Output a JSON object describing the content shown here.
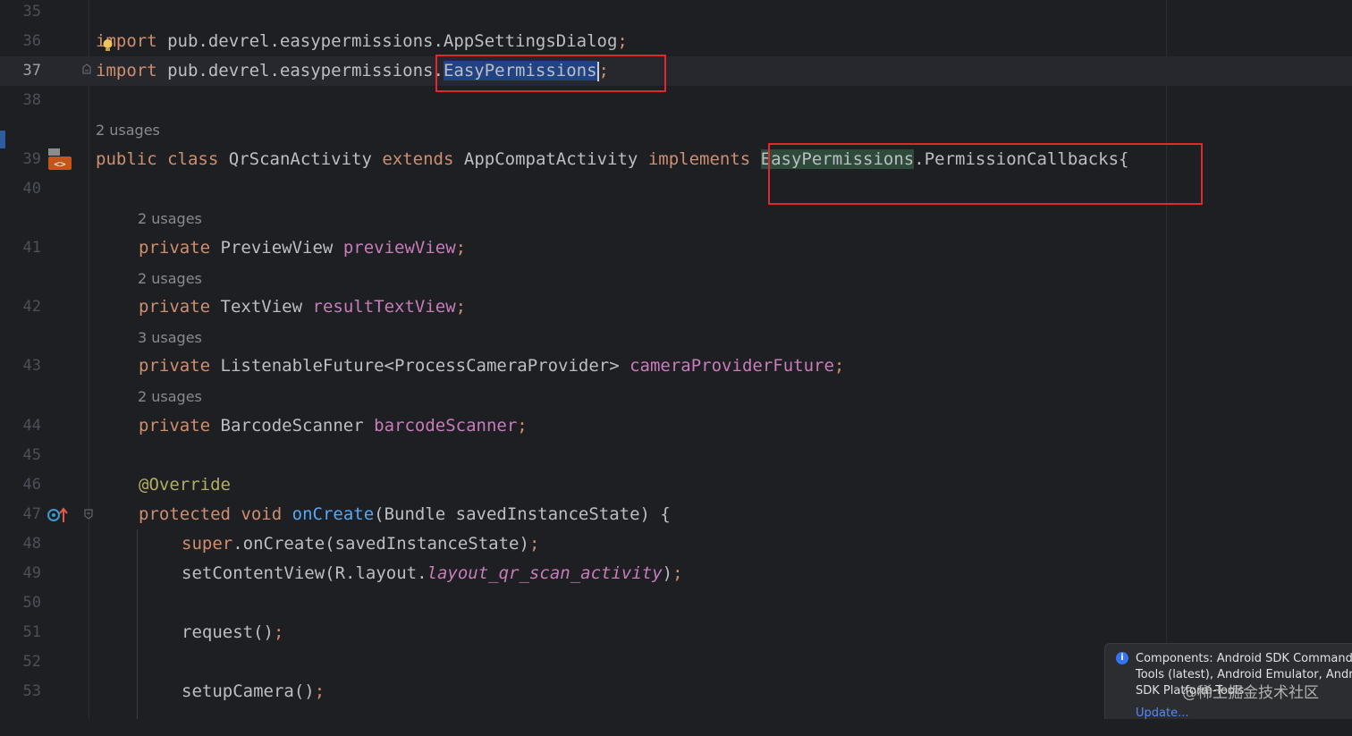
{
  "line_numbers": [
    "35",
    "36",
    "37",
    "38",
    "39",
    "40",
    "41",
    "42",
    "43",
    "44",
    "45",
    "46",
    "47",
    "48",
    "49",
    "50",
    "51",
    "52",
    "53"
  ],
  "usages": {
    "class": "2 usages",
    "preview_view": "2 usages",
    "result_text_view": "2 usages",
    "camera_provider_future": "3 usages",
    "barcode_scanner": "2 usages"
  },
  "code": {
    "l36": {
      "kw": "import",
      "rest": " pub.devrel.easypermissions.AppSettingsDialog",
      "semi": ";"
    },
    "l37": {
      "kw": "import",
      "pkg": " pub.devrel.easypermissions.",
      "selected": "EasyPermissions",
      "semi": ";"
    },
    "l39": {
      "kw1": "public",
      "kw2": "class",
      "name": "QrScanActivity",
      "kw3": "extends",
      "parent": "AppCompatActivity",
      "kw4": "implements",
      "iface_ref": "EasyPermissions",
      "iface_rest": ".PermissionCallbacks{"
    },
    "l41": {
      "kw": "private",
      "type": "PreviewView",
      "field": "previewView",
      "semi": ";"
    },
    "l42": {
      "kw": "private",
      "type": "TextView",
      "field": "resultTextView",
      "semi": ";"
    },
    "l43": {
      "kw": "private",
      "type": "ListenableFuture<ProcessCameraProvider>",
      "field": "cameraProviderFuture",
      "semi": ";"
    },
    "l44": {
      "kw": "private",
      "type": "BarcodeScanner",
      "field": "barcodeScanner",
      "semi": ";"
    },
    "l46": {
      "annotation": "@Override"
    },
    "l47": {
      "kw1": "protected",
      "kw2": "void",
      "method": "onCreate",
      "params": "(Bundle savedInstanceState) {"
    },
    "l48": {
      "kw": "super",
      "rest": ".onCreate(savedInstanceState)",
      "semi": ";"
    },
    "l49": {
      "pre": "setContentView(R.layout.",
      "field": "layout_qr_scan_activity",
      "post": ")",
      "semi": ";"
    },
    "l51": {
      "call": "request()",
      "semi": ";"
    },
    "l53": {
      "call": "setupCamera()",
      "semi": ";"
    }
  },
  "notification": {
    "icon": "info-icon",
    "line1": "Components: Android SDK Command-line",
    "line2": "Tools (latest), Android Emulator, Android",
    "line3": "SDK Platform-Tools",
    "link": "Update..."
  },
  "watermark": "@稀土掘金技术社区",
  "colors": {
    "background": "#1e1f22",
    "keyword": "#cf8e6d",
    "field": "#c77dbb",
    "annotation": "#b3ae60",
    "method": "#56a8f5",
    "selection": "#214283",
    "highlight_box": "#e0282e"
  }
}
